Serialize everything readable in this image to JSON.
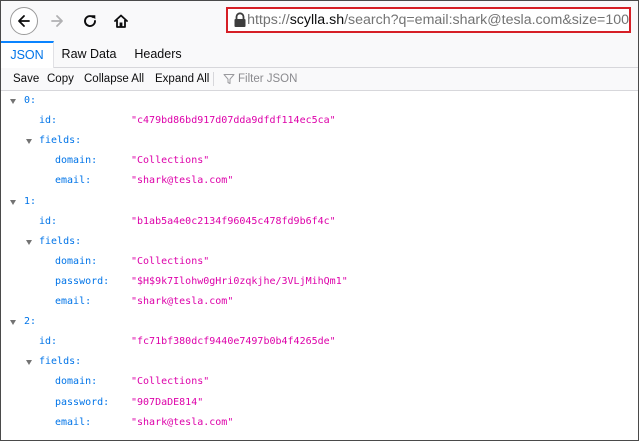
{
  "nav": {
    "url_prefix": "https://",
    "url_host": "scylla.sh",
    "url_rest": "/search?q=email:shark@tesla.com&size=100"
  },
  "tabs": [
    "JSON",
    "Raw Data",
    "Headers"
  ],
  "toolbar": {
    "save": "Save",
    "copy": "Copy",
    "collapse_all": "Collapse All",
    "expand_all": "Expand All",
    "filter_placeholder": "Filter JSON"
  },
  "tree": {
    "rows": [
      {
        "kind": "index",
        "key": "0:",
        "value": ""
      },
      {
        "kind": "prop",
        "key": "id:",
        "value": "\"c479bd86bd917d07dda9dfdf114ec5ca\""
      },
      {
        "kind": "object",
        "key": "fields:",
        "value": ""
      },
      {
        "kind": "field",
        "key": "domain:",
        "value": "\"Collections\""
      },
      {
        "kind": "field",
        "key": "email:",
        "value": "\"shark@tesla.com\""
      },
      {
        "kind": "index",
        "key": "1:",
        "value": ""
      },
      {
        "kind": "prop",
        "key": "id:",
        "value": "\"b1ab5a4e0c2134f96045c478fd9b6f4c\""
      },
      {
        "kind": "object",
        "key": "fields:",
        "value": ""
      },
      {
        "kind": "field",
        "key": "domain:",
        "value": "\"Collections\""
      },
      {
        "kind": "field",
        "key": "password:",
        "value": "\"$H$9k7Ilohw0gHri0zqkjhe/3VLjMihQm1\""
      },
      {
        "kind": "field",
        "key": "email:",
        "value": "\"shark@tesla.com\""
      },
      {
        "kind": "index",
        "key": "2:",
        "value": ""
      },
      {
        "kind": "prop",
        "key": "id:",
        "value": "\"fc71bf380dcf9440e7497b0b4f4265de\""
      },
      {
        "kind": "object",
        "key": "fields:",
        "value": ""
      },
      {
        "kind": "field",
        "key": "domain:",
        "value": "\"Collections\""
      },
      {
        "kind": "field",
        "key": "password:",
        "value": "\"907DaDE814\""
      },
      {
        "kind": "field",
        "key": "email:",
        "value": "\"shark@tesla.com\""
      }
    ]
  }
}
